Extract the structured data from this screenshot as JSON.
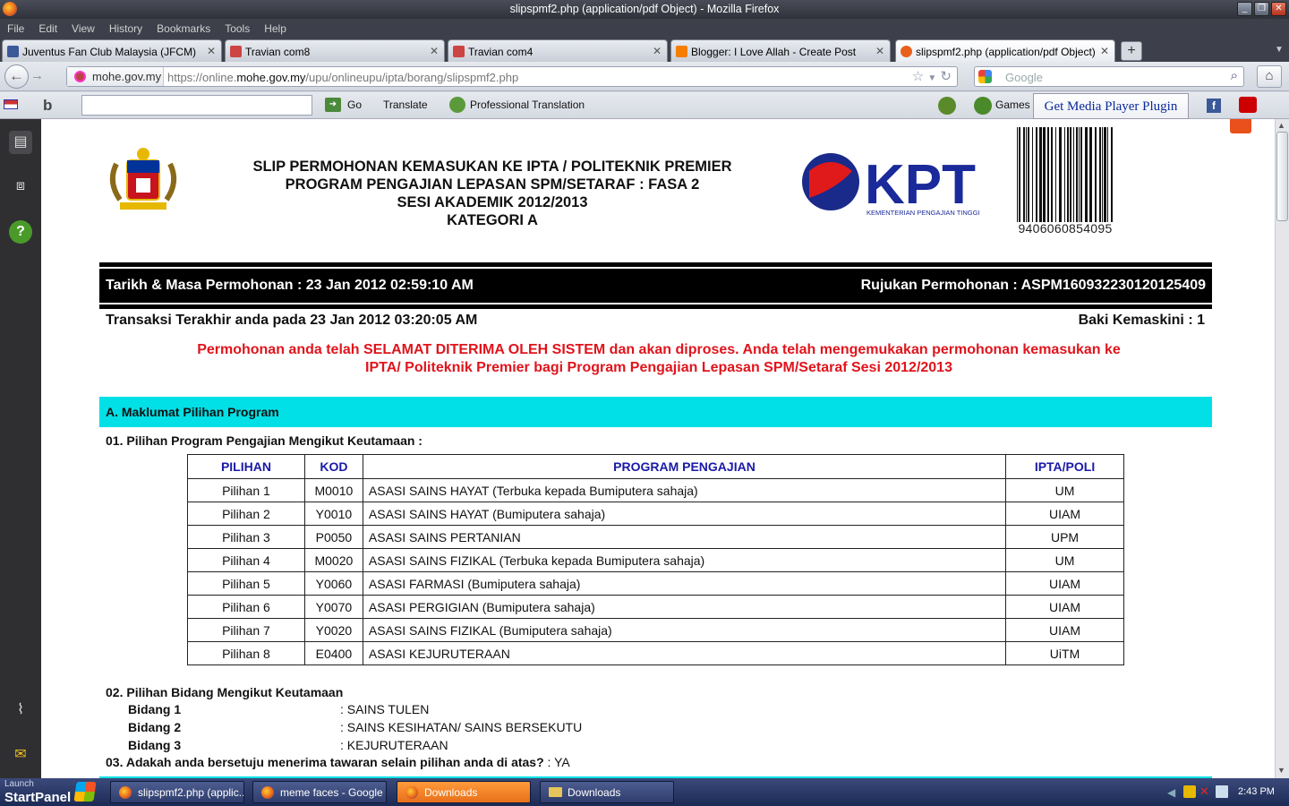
{
  "window": {
    "title": "slipspmf2.php (application/pdf Object) - Mozilla Firefox",
    "controls": {
      "minimize": "_",
      "maximize": "❐",
      "close": "✕"
    }
  },
  "menu": [
    "File",
    "Edit",
    "View",
    "History",
    "Bookmarks",
    "Tools",
    "Help"
  ],
  "tabs": [
    {
      "label": "Juventus Fan Club Malaysia (JFCM)",
      "icon_color": "#3b5998",
      "active": false
    },
    {
      "label": "Travian com8",
      "icon_color": "#c44",
      "active": false
    },
    {
      "label": "Travian com4",
      "icon_color": "#c44",
      "active": false
    },
    {
      "label": "Blogger: I Love Allah - Create Post",
      "icon_color": "#f57d00",
      "active": false
    },
    {
      "label": "slipspmf2.php (application/pdf Object)",
      "icon_color": "#e8601c",
      "active": true
    }
  ],
  "nav": {
    "identity": "mohe.gov.my",
    "url_prefix": "https://online.",
    "url_domain": "mohe.gov.my",
    "url_path": "/upu/onlineupu/ipta/borang/slipspmf2.php",
    "search_placeholder": "Google"
  },
  "toolbar": {
    "go": "Go",
    "translate": "Translate",
    "pro_translation": "Professional Translation",
    "games": "Games",
    "media_plugin": "Get Media Player Plugin"
  },
  "doc": {
    "title_lines": [
      "SLIP PERMOHONAN KEMASUKAN KE IPTA / POLITEKNIK PREMIER",
      "PROGRAM PENGAJIAN LEPASAN SPM/SETARAF : FASA 2",
      "SESI AKADEMIK 2012/2013",
      "KATEGORI A"
    ],
    "kpt_logo_text": "KPT",
    "kpt_logo_sub": "KEMENTERIAN PENGAJIAN TINGGI",
    "barcode_number": "9406060854095",
    "tarikh": "Tarikh & Masa Permohonan : 23 Jan 2012 02:59:10 AM",
    "rujukan": "Rujukan Permohonan : ASPM160932230120125409",
    "transaksi": "Transaksi Terakhir anda pada 23 Jan 2012 03:20:05 AM",
    "baki": "Baki Kemaskini : 1",
    "notice_lines": [
      "Permohonan anda telah SELAMAT DITERIMA OLEH SISTEM dan akan diproses. Anda telah mengemukakan permohonan kemasukan ke",
      "IPTA/ Politeknik Premier bagi Program Pengajian Lepasan SPM/Setaraf Sesi 2012/2013"
    ],
    "section_a": "A. Maklumat Pilihan Program",
    "q1": "01. Pilihan Program Pengajian Mengikut Keutamaan :",
    "table_headers": [
      "PILIHAN",
      "KOD",
      "PROGRAM PENGAJIAN",
      "IPTA/POLI"
    ],
    "table_rows": [
      [
        "Pilihan 1",
        "M0010",
        "ASASI SAINS HAYAT (Terbuka kepada Bumiputera sahaja)",
        "UM"
      ],
      [
        "Pilihan 2",
        "Y0010",
        "ASASI SAINS HAYAT  (Bumiputera sahaja)",
        "UIAM"
      ],
      [
        "Pilihan 3",
        "P0050",
        "ASASI SAINS PERTANIAN",
        "UPM"
      ],
      [
        "Pilihan 4",
        "M0020",
        "ASASI SAINS FIZIKAL (Terbuka kepada Bumiputera sahaja)",
        "UM"
      ],
      [
        "Pilihan 5",
        "Y0060",
        "ASASI FARMASI (Bumiputera sahaja)",
        "UIAM"
      ],
      [
        "Pilihan 6",
        "Y0070",
        "ASASI PERGIGIAN (Bumiputera sahaja)",
        "UIAM"
      ],
      [
        "Pilihan 7",
        "Y0020",
        "ASASI SAINS FIZIKAL (Bumiputera sahaja)",
        "UIAM"
      ],
      [
        "Pilihan 8",
        "E0400",
        "ASASI KEJURUTERAAN",
        "UiTM"
      ]
    ],
    "q2": "02. Pilihan Bidang Mengikut Keutamaan",
    "bidang": [
      {
        "label": "Bidang 1",
        "value": ": SAINS TULEN"
      },
      {
        "label": "Bidang 2",
        "value": ": SAINS KESIHATAN/ SAINS BERSEKUTU"
      },
      {
        "label": "Bidang 3",
        "value": ": KEJURUTERAAN"
      }
    ],
    "q3": "03. Adakah anda bersetuju menerima tawaran selain pilihan anda di atas?",
    "q3_answer": " : YA"
  },
  "taskbar": {
    "launch": "Launch",
    "startpanel": "StartPanel",
    "tasks": [
      {
        "label": "slipspmf2.php (applic...",
        "type": "firefox",
        "highlight": false
      },
      {
        "label": "meme faces - Google ...",
        "type": "firefox",
        "highlight": false
      },
      {
        "label": "Downloads",
        "type": "firefox",
        "highlight": true
      },
      {
        "label": "Downloads",
        "type": "folder",
        "highlight": false
      }
    ],
    "clock": "2:43 PM"
  }
}
